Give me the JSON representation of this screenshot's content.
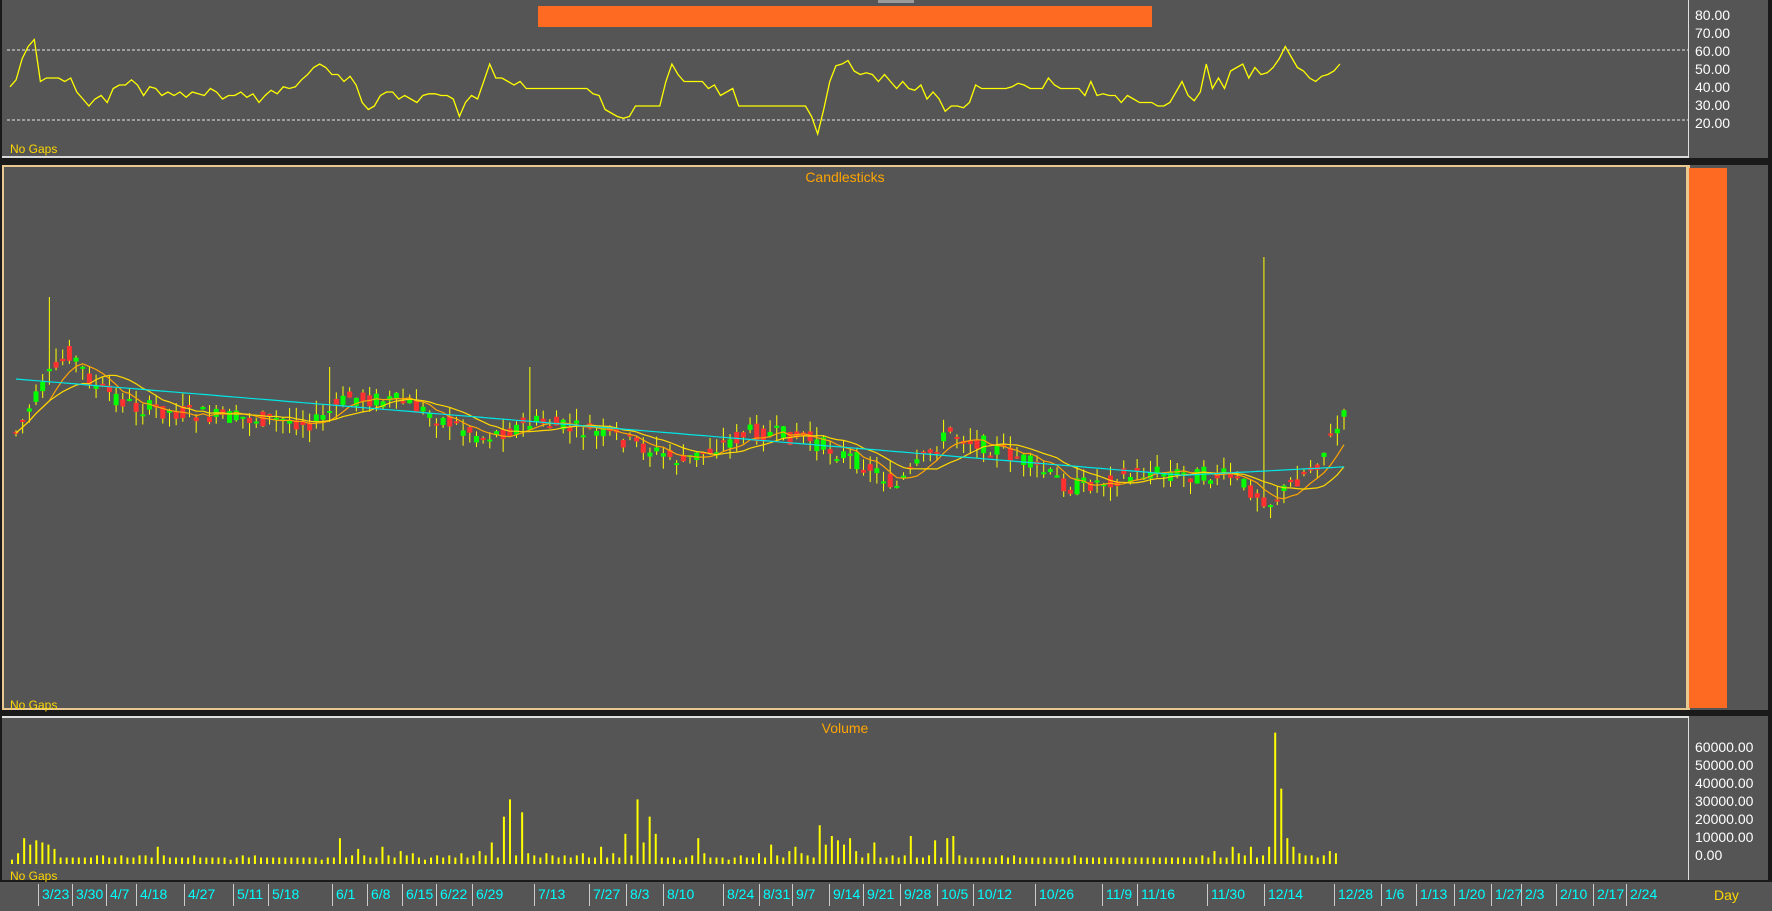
{
  "rsi_panel": {
    "footer": "No Gaps",
    "axis_ticks": [
      "80.00",
      "70.00",
      "60.00",
      "50.00",
      "40.00",
      "30.00",
      "20.00"
    ]
  },
  "candle_panel": {
    "title": "Candlesticks",
    "footer": "No Gaps"
  },
  "volume_panel": {
    "title": "Volume",
    "footer": "No Gaps",
    "axis_ticks": [
      "60000.00",
      "50000.00",
      "40000.00",
      "30000.00",
      "20000.00",
      "10000.00",
      "0.00"
    ]
  },
  "date_axis": {
    "labels": [
      "3/23",
      "3/30",
      "4/7",
      "4/18",
      "4/27",
      "5/11",
      "5/18",
      "6/1",
      "6/8",
      "6/15",
      "6/22",
      "6/29",
      "7/13",
      "7/27",
      "8/3",
      "8/10",
      "8/24",
      "8/31",
      "9/7",
      "9/14",
      "9/21",
      "9/28",
      "10/5",
      "10/12",
      "10/26",
      "11/9",
      "11/16",
      "11/30",
      "12/14",
      "12/28",
      "1/6",
      "1/13",
      "1/20",
      "1/27",
      "2/3",
      "2/10",
      "2/17",
      "2/24"
    ],
    "period": "Day"
  },
  "colors": {
    "panel_bg": "#555555",
    "rsi_line": "#ffff00",
    "up_candle": "#00ff00",
    "down_candle": "#ff3030",
    "ma_fast": "#ffa500",
    "ma_mid": "#ffd700",
    "ma_slow": "#00e5e5",
    "volume_bar": "#ffff00",
    "title": "#ffa500",
    "date_label": "#00ffff"
  },
  "chart_data": [
    {
      "type": "line",
      "series": [
        {
          "values": [
            49,
            53,
            65,
            72,
            76,
            52,
            54,
            54,
            54,
            52,
            54,
            46,
            42,
            38,
            42,
            44,
            40,
            48,
            50,
            50,
            53,
            50,
            44,
            49,
            48,
            44,
            46,
            44,
            46,
            43,
            46,
            45,
            44,
            48,
            46,
            42,
            44,
            44,
            46,
            43,
            45,
            40,
            44,
            47,
            45,
            49,
            48,
            49,
            53,
            56,
            60,
            62,
            60,
            56,
            56,
            52,
            55,
            50,
            40,
            36,
            38,
            44,
            46,
            46,
            42,
            44,
            42,
            40,
            44,
            45,
            45,
            44,
            44,
            42,
            32,
            40,
            44,
            42,
            52,
            62,
            54,
            54,
            52,
            50,
            52,
            48,
            48,
            48,
            48,
            48,
            48,
            48,
            48,
            48,
            48,
            48,
            45,
            44,
            36,
            34,
            32,
            31,
            32,
            38,
            38,
            38,
            38,
            38,
            52,
            62,
            56,
            52,
            52,
            52,
            52,
            48,
            50,
            44,
            46,
            48,
            38,
            38,
            38,
            38,
            38,
            38,
            38,
            38,
            38,
            38,
            38,
            38,
            32,
            22,
            36,
            52,
            61,
            62,
            64,
            58,
            56,
            57,
            56,
            52,
            56,
            52,
            48,
            52,
            48,
            47,
            50,
            42,
            46,
            42,
            35,
            38,
            38,
            37,
            40,
            50,
            48,
            48,
            48,
            48,
            48,
            49,
            51,
            50,
            48,
            48,
            48,
            54,
            50,
            48,
            48,
            48,
            48,
            44,
            52,
            44,
            45,
            44,
            44,
            40,
            44,
            42,
            40,
            40,
            40,
            38,
            38,
            40,
            46,
            52,
            44,
            41,
            46,
            62,
            48,
            54,
            48,
            58,
            60,
            62,
            54,
            60,
            56,
            57,
            60,
            65,
            72,
            66,
            60,
            58,
            54,
            52,
            55,
            56,
            58,
            62
          ]
        }
      ],
      "ylim": [
        10,
        90
      ],
      "reference_lines": [
        70,
        30
      ]
    },
    {
      "type": "candlestick",
      "ylim": [
        0,
        100
      ],
      "moving_averages": [
        "fast",
        "mid",
        "slow"
      ]
    },
    {
      "type": "bar",
      "title": "Volume",
      "ylim": [
        0,
        65000
      ],
      "values": [
        2000,
        5000,
        12000,
        9000,
        11000,
        10000,
        9000,
        7000,
        3000,
        3000,
        3000,
        3000,
        3000,
        3000,
        4000,
        4000,
        3000,
        3000,
        4000,
        3000,
        3000,
        4000,
        4000,
        3000,
        8000,
        4000,
        3000,
        3000,
        3000,
        3000,
        4000,
        3000,
        3000,
        3000,
        3000,
        3000,
        2000,
        3000,
        4000,
        3000,
        4000,
        3000,
        3000,
        3000,
        3000,
        3000,
        3000,
        3000,
        3000,
        3000,
        3000,
        2000,
        3000,
        3000,
        12000,
        3000,
        4000,
        7000,
        4000,
        3000,
        3000,
        8000,
        4000,
        3000,
        6000,
        4000,
        5000,
        3000,
        2000,
        3000,
        4000,
        3000,
        4000,
        3000,
        5000,
        3000,
        4000,
        6000,
        4000,
        10000,
        3000,
        22000,
        30000,
        4000,
        24000,
        5000,
        4000,
        3000,
        5000,
        4000,
        3000,
        4000,
        3000,
        4000,
        5000,
        3000,
        3000,
        8000,
        3000,
        5000,
        3000,
        14000,
        4000,
        30000,
        10000,
        22000,
        14000,
        3000,
        3000,
        3000,
        2000,
        3000,
        4000,
        12000,
        5000,
        3000,
        3000,
        3000,
        2000,
        3000,
        4000,
        3000,
        3000,
        5000,
        3000,
        9000,
        4000,
        3000,
        6000,
        8000,
        5000,
        4000,
        3000,
        18000,
        9000,
        13000,
        11000,
        9000,
        12000,
        6000,
        3000,
        5000,
        10000,
        3000,
        3000,
        4000,
        3000,
        4000,
        13000,
        3000,
        3000,
        4000,
        11000,
        3000,
        12000,
        13000,
        4000,
        3000,
        3000,
        3000,
        3000,
        3000,
        3000,
        4000,
        3000,
        4000,
        3000,
        3000,
        3000,
        3000,
        3000,
        3000,
        3000,
        3000,
        3000,
        4000,
        3000,
        3000,
        3000,
        3000,
        3000,
        3000,
        3000,
        3000,
        3000,
        3000,
        3000,
        3000,
        3000,
        3000,
        3000,
        3000,
        3000,
        3000,
        3000,
        3000,
        4000,
        3000,
        6000,
        3000,
        3000,
        8000,
        5000,
        4000,
        8000,
        3000,
        4000,
        8000,
        61000,
        35000,
        12000,
        8000,
        5000,
        4000,
        4000,
        3000,
        4000,
        6000,
        5000
      ]
    }
  ]
}
